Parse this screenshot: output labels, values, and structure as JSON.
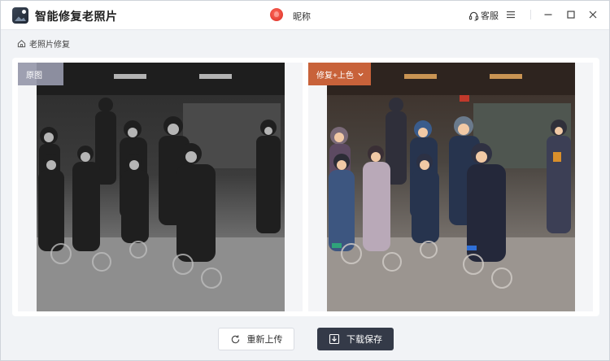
{
  "app": {
    "title": "智能修复老照片"
  },
  "user": {
    "nickname": "昵称"
  },
  "titlebar": {
    "service_label": "客服"
  },
  "breadcrumb": {
    "label": "老照片修复"
  },
  "compare": {
    "original_label": "原图",
    "result_label": "修复+上色"
  },
  "actions": {
    "reupload_label": "重新上传",
    "save_label": "下载保存"
  },
  "icons": {
    "app_logo": "photo-landscape-icon",
    "avatar": "user-avatar",
    "service": "headset-icon",
    "menu": "hamburger-menu-icon",
    "minimize": "minimize-icon",
    "maximize": "maximize-icon",
    "close": "close-icon",
    "breadcrumb": "home-icon",
    "dropdown": "chevron-down-icon",
    "reupload": "refresh-icon",
    "save": "download-icon"
  },
  "colors": {
    "accent": "#c8623a",
    "primary_button": "#343a48",
    "original_tag": "#9698aa"
  }
}
